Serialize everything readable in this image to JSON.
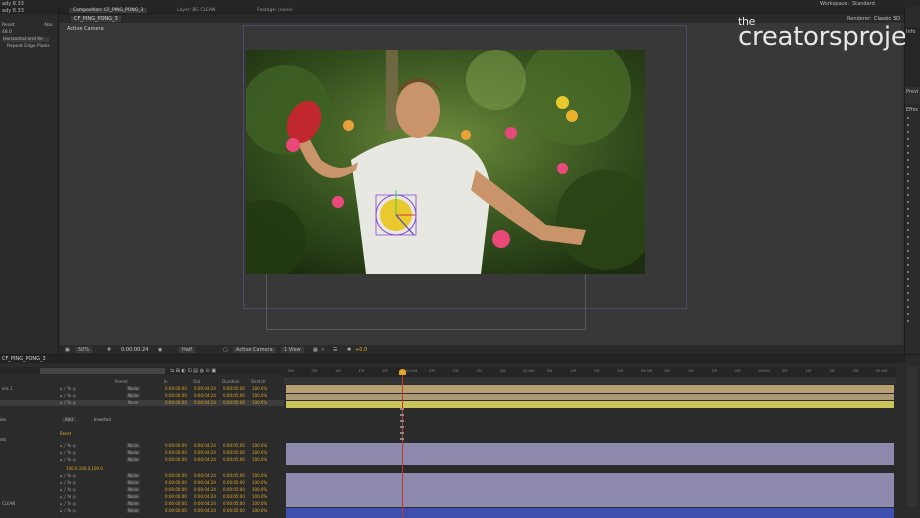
{
  "menubar": {
    "items": [
      "ady  8.33",
      "Workspace:",
      "Standard"
    ]
  },
  "composition_panel": {
    "tabs": [
      {
        "label": "Composition: CF_PING_PONG_3",
        "active": true
      },
      {
        "label": "Layer: BG CLEAN",
        "active": false
      },
      {
        "label": "Footage: (none)",
        "active": false
      }
    ],
    "subtab": "CF_PING_PONG_3",
    "renderer_label": "Renderer:",
    "renderer_value": "Classic 3D",
    "view_label": "Active Camera",
    "footer": {
      "zoom": "50%",
      "timecode": "0:00:00:24",
      "resolution": "Half",
      "camera": "Active Camera",
      "views": "1 View",
      "exposure": "+0.0"
    }
  },
  "left_panel": {
    "title": "ady  8.33",
    "rows": [
      {
        "label": "Reset",
        "right": "Abo",
        "highlight": true
      },
      {
        "label": "48.0",
        "right": "",
        "highlight": true
      },
      {
        "label": "Horizontal and Ve",
        "right": "",
        "highlight": false
      },
      {
        "label": "Repeat Edge Pixels",
        "right": "",
        "highlight": false
      }
    ]
  },
  "watermark": {
    "line1": "the",
    "line2": "creatorsproject"
  },
  "right_panel": {
    "label_top": "Info",
    "label_mid": "Previ",
    "label_eff": "Effec"
  },
  "timeline": {
    "tab": "CF_PING_PONG_3",
    "column_headers": [
      "Parent",
      "In",
      "Out",
      "Duration",
      "Stretch"
    ],
    "ruler_labels": [
      "00f",
      "05f",
      "10f",
      "15f",
      "20f",
      "01:00f",
      "05f",
      "10f",
      "15f",
      "20f",
      "02:00f",
      "05f",
      "10f",
      "15f",
      "20f",
      "03:00f",
      "05f",
      "10f",
      "15f",
      "20f",
      "04:00f",
      "05f",
      "10f",
      "15f",
      "20f",
      "05:00f"
    ],
    "mid_labels": {
      "mode": "Add",
      "inverted": "Inverted",
      "reset": "Reset",
      "scale": "100.0,100.0,100.0"
    },
    "layers": [
      {
        "name": "era 1",
        "parent": "None",
        "in": "0:00:00:00",
        "out": "0:00:04:24",
        "dur": "0:00:05:00",
        "stretch": "100.0%"
      },
      {
        "name": "",
        "parent": "None",
        "in": "0:00:00:00",
        "out": "0:00:04:24",
        "dur": "0:00:05:00",
        "stretch": "100.0%"
      },
      {
        "name": "",
        "parent": "None",
        "in": "0:00:00:00",
        "out": "0:00:04:24",
        "dur": "0:00:05:00",
        "stretch": "100.0%"
      },
      {
        "name": "",
        "parent": "None",
        "in": "0:00:00:00",
        "out": "0:00:04:24",
        "dur": "0:00:05:00",
        "stretch": "100.0%"
      },
      {
        "name": "",
        "parent": "None",
        "in": "0:00:00:00",
        "out": "0:00:04:24",
        "dur": "0:00:05:00",
        "stretch": "100.0%"
      },
      {
        "name": "",
        "parent": "None",
        "in": "0:00:00:00",
        "out": "0:00:04:24",
        "dur": "0:00:05:00",
        "stretch": "100.0%"
      },
      {
        "name": "",
        "parent": "None",
        "in": "0:00:00:00",
        "out": "0:00:04:24",
        "dur": "0:00:05:00",
        "stretch": "100.0%"
      },
      {
        "name": "",
        "parent": "None",
        "in": "0:00:00:00",
        "out": "0:00:04:24",
        "dur": "0:00:05:00",
        "stretch": "100.0%"
      },
      {
        "name": "",
        "parent": "None",
        "in": "0:00:00:00",
        "out": "0:00:04:24",
        "dur": "0:00:05:00",
        "stretch": "100.0%"
      },
      {
        "name": "",
        "parent": "None",
        "in": "0:00:00:00",
        "out": "0:00:04:24",
        "dur": "0:00:05:00",
        "stretch": "100.0%"
      },
      {
        "name": "CLEAN",
        "parent": "None",
        "in": "0:00:00:00",
        "out": "0:00:04:24",
        "dur": "0:00:05:00",
        "stretch": "100.0%"
      },
      {
        "name": "",
        "parent": "None",
        "in": "0:00:00:00",
        "out": "0:00:04:24",
        "dur": "0:00:05:00",
        "stretch": "100.0%"
      }
    ],
    "side_labels": [
      "nts",
      "ion"
    ]
  },
  "colors": {
    "bar_tan": "#b8a070",
    "bar_yellow": "#c9c35a",
    "bar_lavender": "#8e8aae",
    "bar_blue": "#3f4fae",
    "cti_line": "#c0392b",
    "accent_yellow": "#e3a825"
  }
}
